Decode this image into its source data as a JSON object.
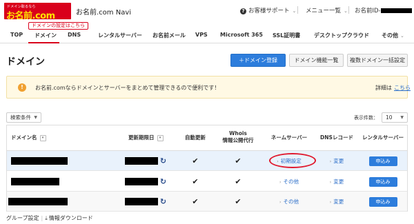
{
  "header": {
    "logo_tagline": "ドメイン取るなら",
    "logo_text": "お名前.com",
    "app_title": "お名前.com Navi",
    "support_icon": "question-circle-icon",
    "support_label": "お客様サポート",
    "menu_label": "メニュー一覧",
    "user_id_label": "お名前ID-",
    "caret_glyph": "⌄"
  },
  "tooltip": {
    "text": "ドメインの設定はこちら"
  },
  "nav": {
    "items": [
      "TOP",
      "ドメイン",
      "DNS",
      "レンタルサーバー",
      "お名前メール",
      "VPS",
      "Microsoft 365",
      "SSL証明書",
      "デスクトップクラウド",
      "その他"
    ],
    "active_index": 1
  },
  "page": {
    "title": "ドメイン",
    "buttons": {
      "register": "＋ドメイン登録",
      "functions": "ドメイン機能一覧",
      "bulk_settings": "複数ドメイン一括設定"
    }
  },
  "notice": {
    "icon": "exclamation-icon",
    "text": "お名前.comならドメインとサーバーをまとめて管理できるので便利です！",
    "detail_prefix": "詳細は",
    "detail_link": "こちら"
  },
  "filter": {
    "search_condition_label": "検索条件",
    "per_page_label": "表示件数：",
    "per_page_value": "10"
  },
  "table": {
    "headers": {
      "domain": "ドメイン名",
      "expiry": "更新期限日",
      "auto_renew": "自動更新",
      "whois_line1": "Whois",
      "whois_line2": "情報公開代行",
      "nameserver": "ネームサーバー",
      "dns_record": "DNSレコード",
      "rental_server": "レンタルサーバー"
    },
    "rows": [
      {
        "nameserver": "初期設定",
        "dns_record": "変更",
        "rental_server": "申込み",
        "highlighted": true
      },
      {
        "nameserver": "その他",
        "dns_record": "変更",
        "rental_server": "申込み",
        "highlighted": false
      },
      {
        "nameserver": "その他",
        "dns_record": "変更",
        "rental_server": "申込み",
        "highlighted": false
      }
    ],
    "check_glyph": "✔",
    "refresh_glyph": "↻",
    "sort_glyph": "▾",
    "chevron_glyph": "›"
  },
  "footer": {
    "group_settings": "グループ設定",
    "download": "情報ダウンロード"
  },
  "colors": {
    "brand_red": "#d9001b",
    "accent_blue": "#2d7ddc",
    "notice_bg": "#fff9e4",
    "highlight_row": "#e9f2fc",
    "annotation_circle": "#e0192d"
  }
}
